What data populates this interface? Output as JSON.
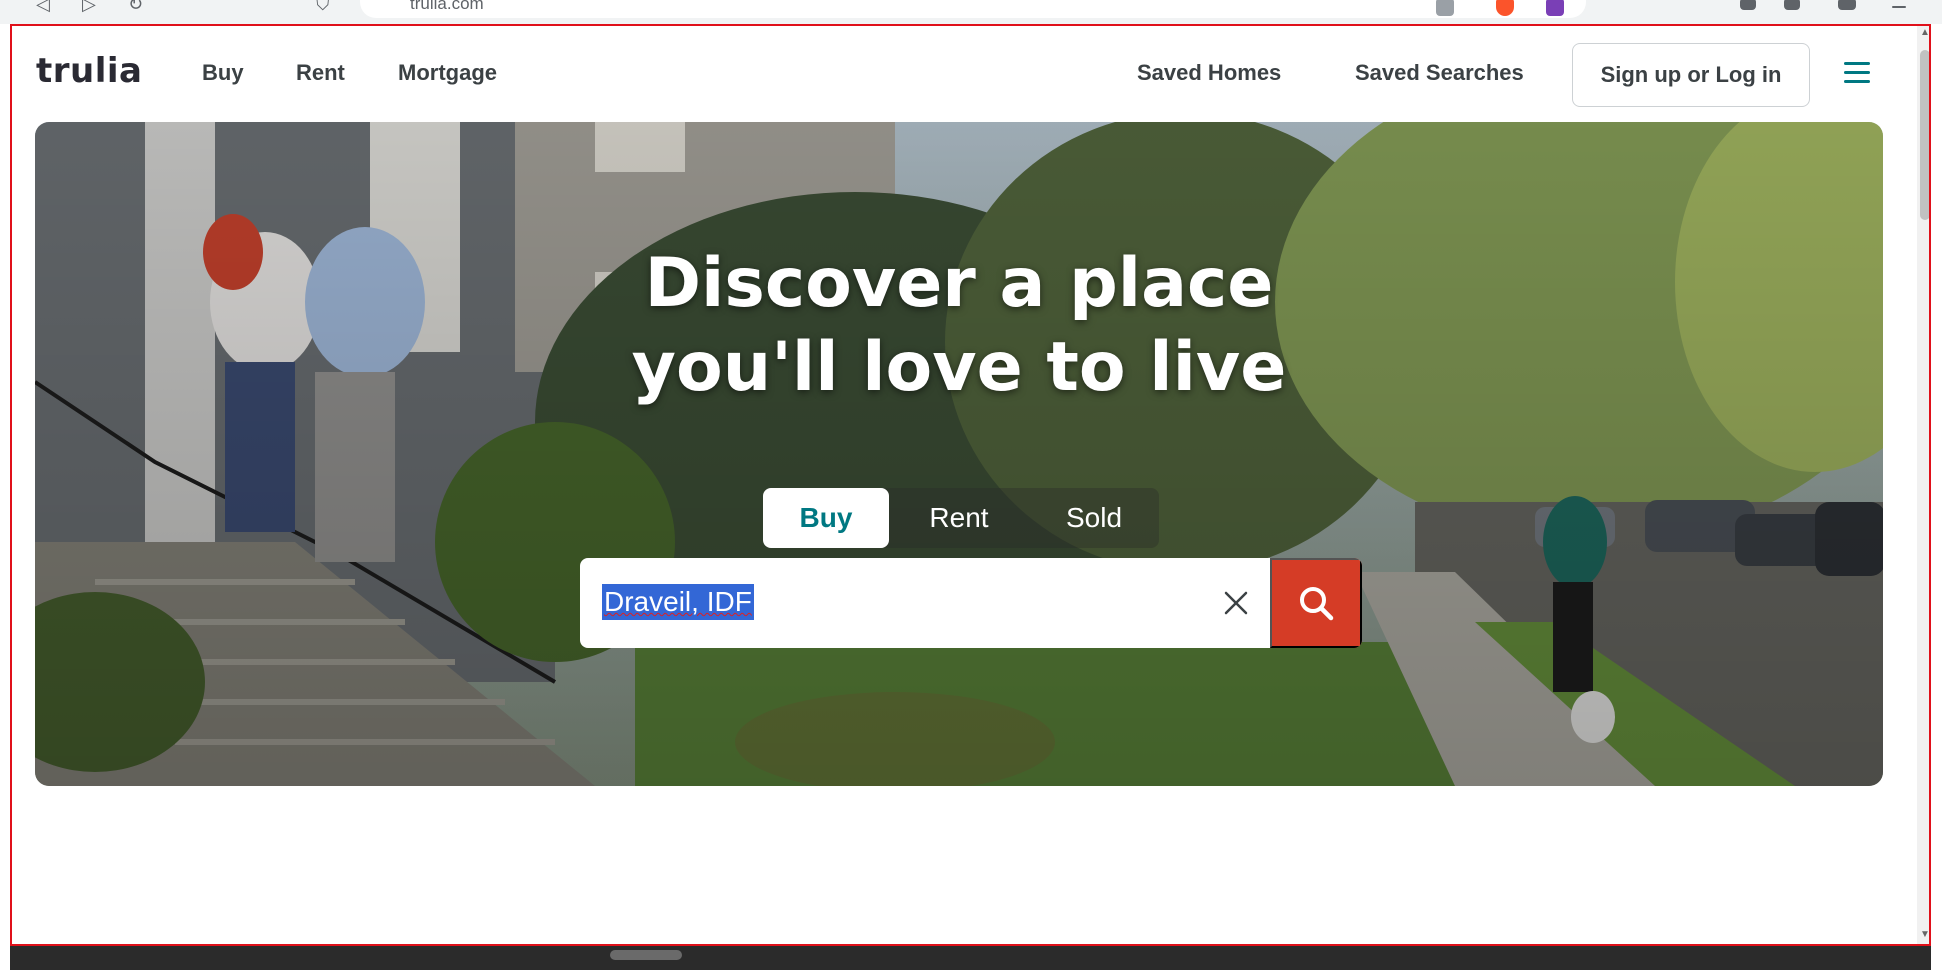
{
  "browser": {
    "url": "trulia.com"
  },
  "header": {
    "logo": "trulia",
    "nav": [
      "Buy",
      "Rent",
      "Mortgage"
    ],
    "saved_homes": "Saved Homes",
    "saved_searches": "Saved Searches",
    "login": "Sign up or Log in"
  },
  "hero": {
    "title_line1": "Discover a place",
    "title_line2": "you'll love to live",
    "tabs": [
      "Buy",
      "Rent",
      "Sold"
    ],
    "active_tab": "Buy",
    "search_value": "Draveil, IDF"
  },
  "colors": {
    "brand_teal": "#007882",
    "search_button": "#d53c26",
    "selection": "#3367d6"
  }
}
